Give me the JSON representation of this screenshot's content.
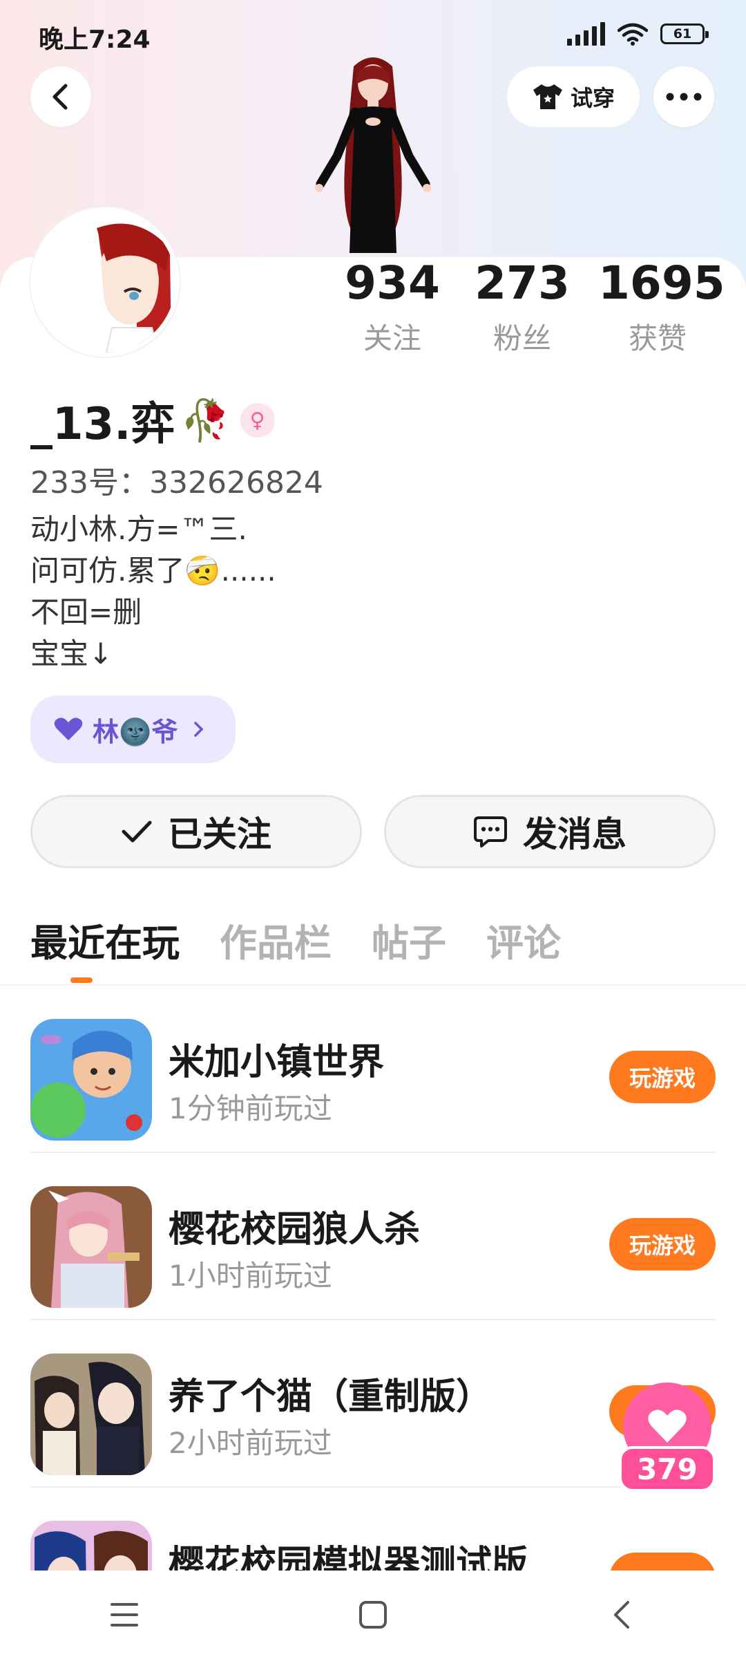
{
  "status_bar": {
    "time": "晚上7:24",
    "battery": "61"
  },
  "header": {
    "try_on_label": "试穿"
  },
  "stats": [
    {
      "value": "934",
      "label": "关注"
    },
    {
      "value": "273",
      "label": "粉丝"
    },
    {
      "value": "1695",
      "label": "获赞"
    }
  ],
  "profile": {
    "username": "_13.弈",
    "username_emoji": "🥀",
    "gender_symbol": "♀",
    "uid": "233号：332626824",
    "bio": [
      "动小林.方=™三.",
      "问可仿.累了🤕......",
      "不回=删",
      "宝宝↓"
    ]
  },
  "friend_tag": {
    "label": "林🌚爷"
  },
  "actions": {
    "follow_label": "已关注",
    "message_label": "发消息"
  },
  "tabs": [
    "最近在玩",
    "作品栏",
    "帖子",
    "评论"
  ],
  "games": [
    {
      "title": "米加小镇世界",
      "meta": "1分钟前玩过",
      "button": "玩游戏"
    },
    {
      "title": "樱花校园狼人杀",
      "meta": "1小时前玩过",
      "button": "玩游戏"
    },
    {
      "title": "养了个猫（重制版）",
      "meta": "2小时前玩过",
      "button": ""
    },
    {
      "title": "樱花校园模拟器测试版",
      "meta": "",
      "button": ""
    }
  ],
  "like_badge": {
    "count": "379"
  },
  "colors": {
    "accent": "#ff7a1f",
    "like_pink": "#ff4f98",
    "tag_purple": "#6a55d4"
  }
}
